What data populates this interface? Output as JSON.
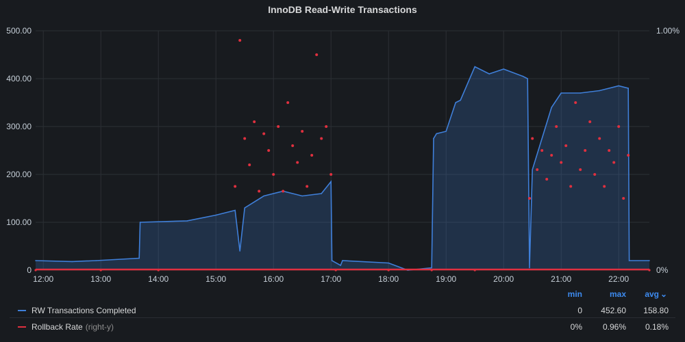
{
  "panel": {
    "title": "InnoDB Read-Write Transactions"
  },
  "chart_data": {
    "type": "line",
    "title": "InnoDB Read-Write Transactions",
    "x_ticks": [
      "12:00",
      "13:00",
      "14:00",
      "15:00",
      "16:00",
      "17:00",
      "18:00",
      "19:00",
      "20:00",
      "21:00",
      "22:00"
    ],
    "x_range": [
      "11:52",
      "22:32"
    ],
    "y_left": {
      "ticks": [
        "0",
        "100.00",
        "200.00",
        "300.00",
        "400.00",
        "500.00"
      ],
      "range": [
        0,
        500
      ]
    },
    "y_right": {
      "ticks": [
        "0%",
        "1.00%"
      ],
      "range": [
        0,
        1
      ]
    },
    "grid": true,
    "series": [
      {
        "name": "RW Transactions Completed",
        "axis": "left",
        "style": "line-fill",
        "color": "#3f7fd9",
        "x": [
          "11:52",
          "12:30",
          "12:55",
          "13:40",
          "13:41",
          "14:30",
          "15:00",
          "15:20",
          "15:25",
          "15:30",
          "15:50",
          "16:10",
          "16:30",
          "16:50",
          "17:00",
          "17:01",
          "17:10",
          "17:12",
          "18:00",
          "18:20",
          "18:45",
          "18:47",
          "18:50",
          "19:00",
          "19:10",
          "19:15",
          "19:30",
          "19:45",
          "20:00",
          "20:20",
          "20:25",
          "20:27",
          "20:30",
          "20:50",
          "21:00",
          "21:20",
          "21:40",
          "22:00",
          "22:10",
          "22:11",
          "22:32"
        ],
        "values": [
          20,
          18,
          20,
          25,
          100,
          103,
          115,
          125,
          40,
          130,
          155,
          165,
          155,
          160,
          185,
          20,
          10,
          20,
          15,
          0,
          5,
          275,
          285,
          290,
          350,
          355,
          425,
          410,
          420,
          405,
          400,
          5,
          210,
          340,
          370,
          370,
          375,
          385,
          380,
          20,
          20
        ]
      },
      {
        "name": "Rollback Rate",
        "axis": "right",
        "axis_note": "(right-y)",
        "style": "points",
        "color": "#e0303f",
        "x": [
          "11:52",
          "13:00",
          "14:00",
          "15:20",
          "15:25",
          "15:30",
          "15:35",
          "15:40",
          "15:45",
          "15:50",
          "15:55",
          "16:00",
          "16:05",
          "16:10",
          "16:15",
          "16:20",
          "16:25",
          "16:30",
          "16:35",
          "16:40",
          "16:45",
          "16:50",
          "16:55",
          "17:00",
          "17:05",
          "18:00",
          "18:45",
          "19:30",
          "20:27",
          "20:30",
          "20:35",
          "20:40",
          "20:45",
          "20:50",
          "20:55",
          "21:00",
          "21:05",
          "21:10",
          "21:15",
          "21:20",
          "21:25",
          "21:30",
          "21:35",
          "21:40",
          "21:45",
          "21:50",
          "21:55",
          "22:00",
          "22:05",
          "22:10",
          "22:32"
        ],
        "values": [
          0,
          0,
          0,
          0.35,
          0.96,
          0.55,
          0.44,
          0.62,
          0.33,
          0.57,
          0.5,
          0.4,
          0.6,
          0.33,
          0.7,
          0.52,
          0.45,
          0.58,
          0.35,
          0.48,
          0.9,
          0.55,
          0.6,
          0.4,
          0,
          0,
          0,
          0,
          0.3,
          0.55,
          0.42,
          0.5,
          0.38,
          0.48,
          0.6,
          0.45,
          0.52,
          0.35,
          0.7,
          0.42,
          0.5,
          0.62,
          0.4,
          0.55,
          0.35,
          0.5,
          0.45,
          0.6,
          0.3,
          0.48,
          0
        ]
      }
    ]
  },
  "legend": {
    "headers": {
      "min": "min",
      "max": "max",
      "avg": "avg",
      "avg_caret": "⌄"
    },
    "rows": [
      {
        "name": "RW Transactions Completed",
        "sub": "",
        "color": "#3f7fd9",
        "min": "0",
        "max": "452.60",
        "avg": "158.80"
      },
      {
        "name": "Rollback Rate",
        "sub": "(right-y)",
        "color": "#e0303f",
        "min": "0%",
        "max": "0.96%",
        "avg": "0.18%"
      }
    ]
  }
}
